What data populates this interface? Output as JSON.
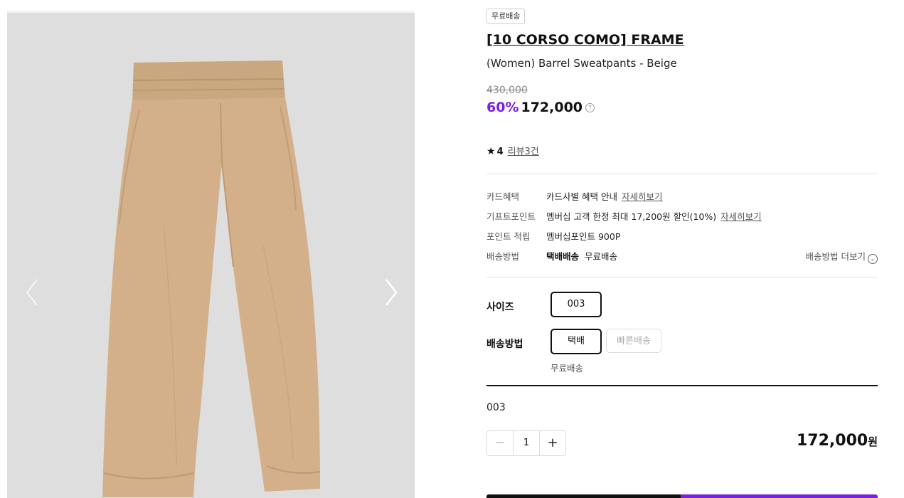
{
  "product": {
    "badge": "무료배송",
    "brand": "[10 CORSO COMO] FRAME",
    "name": "(Women) Barrel Sweatpants - Beige",
    "original_price": "430,000",
    "discount": "60%",
    "price": "172,000",
    "rating": "4",
    "review_link": "리뷰3건"
  },
  "benefits": [
    {
      "label": "카드혜택",
      "value": "카드사별 혜택 안내",
      "link": "자세히보기"
    },
    {
      "label": "기프트포인트",
      "value": "멤버십 고객 한정 최대 17,200원 할인(10%)",
      "link": "자세히보기"
    },
    {
      "label": "포인트 적립",
      "value": "멤버십포인트 900P"
    },
    {
      "label": "배송방법",
      "method": "택배배송",
      "value": "무료배송",
      "more": "배송방법 더보기"
    }
  ],
  "options": {
    "size_label": "사이즈",
    "size_value": "003",
    "ship_label": "배송방법",
    "ship_selected": "택배",
    "ship_alt": "빠른배송",
    "ship_note": "무료배송"
  },
  "selection": {
    "option": "003",
    "quantity": "1",
    "total": "172,000",
    "currency": "원"
  },
  "colors": {
    "discount": "#7b1fe4",
    "buy_primary": "#7b1fe4",
    "buy_secondary": "#111111"
  },
  "icons": [
    "chevron-left-icon",
    "chevron-right-icon",
    "star-icon",
    "question-icon",
    "chevron-down-circle-icon",
    "minus-icon",
    "plus-icon"
  ]
}
